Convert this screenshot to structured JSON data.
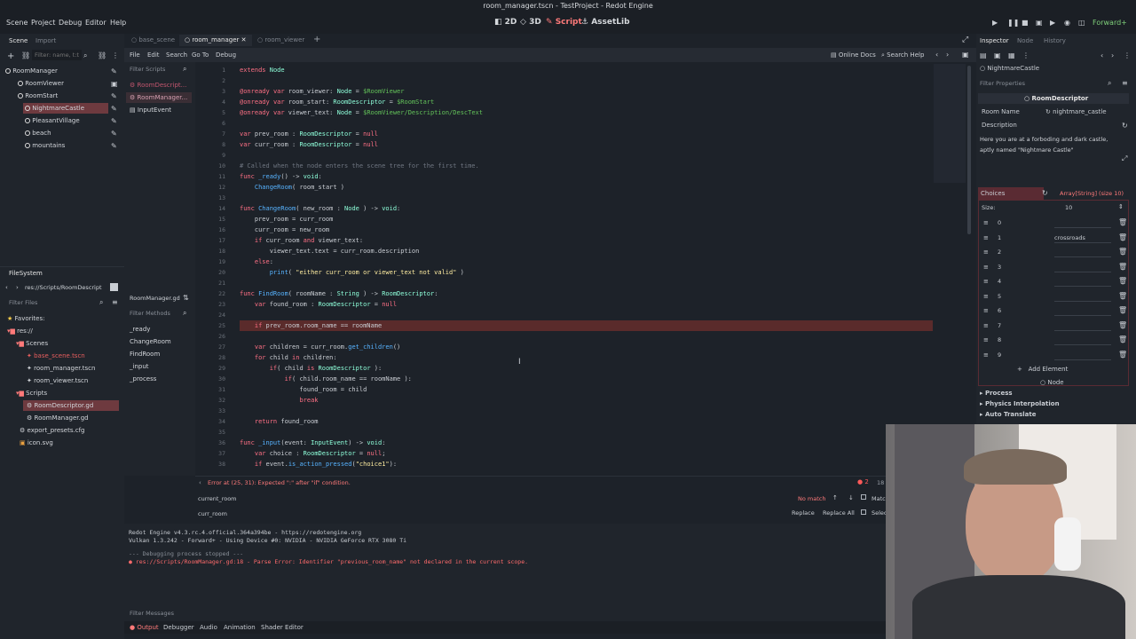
{
  "window": {
    "title": "room_manager.tscn - TestProject - Redot Engine"
  },
  "menu": {
    "scene": "Scene",
    "project": "Project",
    "debug": "Debug",
    "editor": "Editor",
    "help": "Help"
  },
  "workspaces": {
    "ws_2d": "2D",
    "ws_3d": "3D",
    "script": "Script",
    "assetlib": "AssetLib"
  },
  "renderer": "Forward+",
  "scene_dock": {
    "tabs": [
      "Scene",
      "Import"
    ],
    "filter_placeholder": "Filter: name, t:t",
    "nodes": [
      "RoomManager",
      "RoomViewer",
      "RoomStart",
      "NightmareCastle",
      "PleasantVillage",
      "beach",
      "mountains"
    ]
  },
  "filesystem": {
    "title": "FileSystem",
    "path": "res://Scripts/RoomDescript",
    "filter_placeholder": "Filter Files",
    "favorites": "Favorites:",
    "root": "res://",
    "scenes_folder": "Scenes",
    "scene_files": [
      "base_scene.tscn",
      "room_manager.tscn",
      "room_viewer.tscn"
    ],
    "scripts_folder": "Scripts",
    "script_files": [
      "RoomDescriptor.gd",
      "RoomManager.gd"
    ],
    "other_files": [
      "export_presets.cfg",
      "icon.svg"
    ]
  },
  "editor_tabs": [
    "base_scene",
    "room_manager",
    "room_viewer"
  ],
  "script_menu": {
    "file": "File",
    "edit": "Edit",
    "search": "Search",
    "goto": "Go To",
    "debug": "Debug",
    "online_docs": "Online Docs",
    "search_help": "Search Help"
  },
  "script_list": {
    "filter_placeholder": "Filter Scripts",
    "items": [
      "RoomDescript...",
      "RoomManager...",
      "InputEvent"
    ],
    "current": "RoomManager.gd",
    "methods_placeholder": "Filter Methods",
    "methods": [
      "_ready",
      "ChangeRoom",
      "FindRoom",
      "_input",
      "_process"
    ]
  },
  "code_lines": [
    {
      "n": "1",
      "t": "extends Node"
    },
    {
      "n": "2",
      "t": ""
    },
    {
      "n": "3",
      "t": "@onready var room_viewer: Node = $RoomViewer"
    },
    {
      "n": "4",
      "t": "@onready var room_start: RoomDescriptor = $RoomStart"
    },
    {
      "n": "5",
      "t": "@onready var viewer_text: Node = $RoomViewer/Description/DescText"
    },
    {
      "n": "6",
      "t": ""
    },
    {
      "n": "7",
      "t": "var prev_room : RoomDescriptor = null"
    },
    {
      "n": "8",
      "t": "var curr_room : RoomDescriptor = null"
    },
    {
      "n": "9",
      "t": ""
    },
    {
      "n": "10",
      "t": "# Called when the node enters the scene tree for the first time."
    },
    {
      "n": "11",
      "t": "func _ready() -> void:"
    },
    {
      "n": "12",
      "t": "    ChangeRoom( room_start )"
    },
    {
      "n": "13",
      "t": ""
    },
    {
      "n": "14",
      "t": "func ChangeRoom( new_room : Node ) -> void:"
    },
    {
      "n": "15",
      "t": "    prev_room = curr_room"
    },
    {
      "n": "16",
      "t": "    curr_room = new_room"
    },
    {
      "n": "17",
      "t": "    if curr_room and viewer_text:"
    },
    {
      "n": "18",
      "t": "        viewer_text.text = curr_room.description"
    },
    {
      "n": "19",
      "t": "    else:"
    },
    {
      "n": "20",
      "t": "        print( \"either curr_room or viewer_text not valid\" )"
    },
    {
      "n": "21",
      "t": ""
    },
    {
      "n": "22",
      "t": "func FindRoom( roomName : String ) -> RoomDescriptor:"
    },
    {
      "n": "23",
      "t": "    var found_room : RoomDescriptor = null"
    },
    {
      "n": "24",
      "t": ""
    },
    {
      "n": "25",
      "t": "    if prev_room.room_name == roomName"
    },
    {
      "n": "26",
      "t": ""
    },
    {
      "n": "27",
      "t": "    var children = curr_room.get_children()"
    },
    {
      "n": "28",
      "t": "    for child in children:"
    },
    {
      "n": "29",
      "t": "        if( child is RoomDescriptor ):"
    },
    {
      "n": "30",
      "t": "            if( child.room_name == roomName ):"
    },
    {
      "n": "31",
      "t": "                found_room = child"
    },
    {
      "n": "32",
      "t": "                break"
    },
    {
      "n": "33",
      "t": ""
    },
    {
      "n": "34",
      "t": "    return found_room"
    },
    {
      "n": "35",
      "t": ""
    },
    {
      "n": "36",
      "t": "func _input(event: InputEvent) -> void:"
    },
    {
      "n": "37",
      "t": "    var choice : RoomDescriptor = null;"
    },
    {
      "n": "38",
      "t": "    if event.is_action_pressed(\"choice1\"):"
    }
  ],
  "status": {
    "error": "Error at (25, 31): Expected \":\" after \"if\" condition.",
    "error_count": "2",
    "col": "18"
  },
  "find": {
    "find_value": "current_room",
    "replace_value": "curr_room",
    "no_match": "No match",
    "match_label": "Matc",
    "replace": "Replace",
    "replace_all": "Replace All",
    "selection": "Selec"
  },
  "output": {
    "line1": "Redot Engine v4.3.rc.4.official.364a394be - https://redotengine.org",
    "line2": "Vulkan 1.3.242 - Forward+ - Using Device #0: NVIDIA - NVIDIA GeForce RTX 3080 Ti",
    "line3": "--- Debugging process stopped ---",
    "line4": "res://Scripts/RoomManager.gd:18 - Parse Error: Identifier \"previous_room_name\" not declared in the current scope.",
    "filter_placeholder": "Filter Messages"
  },
  "bottom_tabs": [
    "Output",
    "Debugger",
    "Audio",
    "Animation",
    "Shader Editor"
  ],
  "inspector": {
    "tabs": [
      "Inspector",
      "Node",
      "History"
    ],
    "object": "NightmareCastle",
    "filter_placeholder": "Filter Properties",
    "class_name": "RoomDescriptor",
    "room_name_label": "Room Name",
    "room_name_value": "nightmare_castle",
    "description_label": "Description",
    "description_value": "Here you are at a forboding and dark castle, aptly named \"Nightmare Castle\"",
    "choices_label": "Choices",
    "choices_type": "Array[String] (size 10)",
    "size_label": "Size:",
    "size_value": "10",
    "elements": [
      {
        "i": "0",
        "v": ""
      },
      {
        "i": "1",
        "v": "crossroads"
      },
      {
        "i": "2",
        "v": ""
      },
      {
        "i": "3",
        "v": ""
      },
      {
        "i": "4",
        "v": ""
      },
      {
        "i": "5",
        "v": ""
      },
      {
        "i": "6",
        "v": ""
      },
      {
        "i": "7",
        "v": ""
      },
      {
        "i": "8",
        "v": ""
      },
      {
        "i": "9",
        "v": ""
      }
    ],
    "add_element": "Add Element",
    "node_section": "Node",
    "sections": [
      "Process",
      "Physics Interpolation",
      "Auto Translate"
    ]
  },
  "colors": {
    "accent": "#ff7a7a",
    "error_line": "#5a2b2b",
    "selected": "#6e3a3f"
  }
}
